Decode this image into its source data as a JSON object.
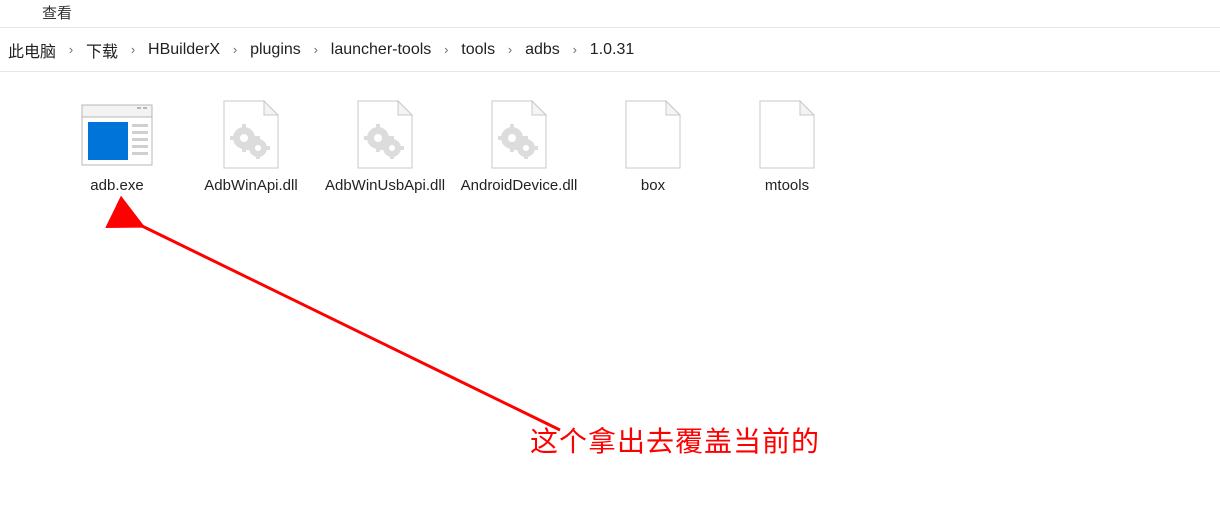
{
  "menu": {
    "view": "查看"
  },
  "breadcrumb": {
    "items": [
      {
        "label": "此电脑"
      },
      {
        "label": "下载"
      },
      {
        "label": "HBuilderX"
      },
      {
        "label": "plugins"
      },
      {
        "label": "launcher-tools"
      },
      {
        "label": "tools"
      },
      {
        "label": "adbs"
      },
      {
        "label": "1.0.31"
      }
    ]
  },
  "files": [
    {
      "name": "adb.exe",
      "kind": "exe"
    },
    {
      "name": "AdbWinApi.dll",
      "kind": "dll"
    },
    {
      "name": "AdbWinUsbApi.dll",
      "kind": "dll"
    },
    {
      "name": "AndroidDevice.dll",
      "kind": "dll"
    },
    {
      "name": "box",
      "kind": "blank"
    },
    {
      "name": "mtools",
      "kind": "blank"
    }
  ],
  "annotation": {
    "text": "这个拿出去覆盖当前的"
  },
  "colors": {
    "accent_red": "#ff0000"
  }
}
